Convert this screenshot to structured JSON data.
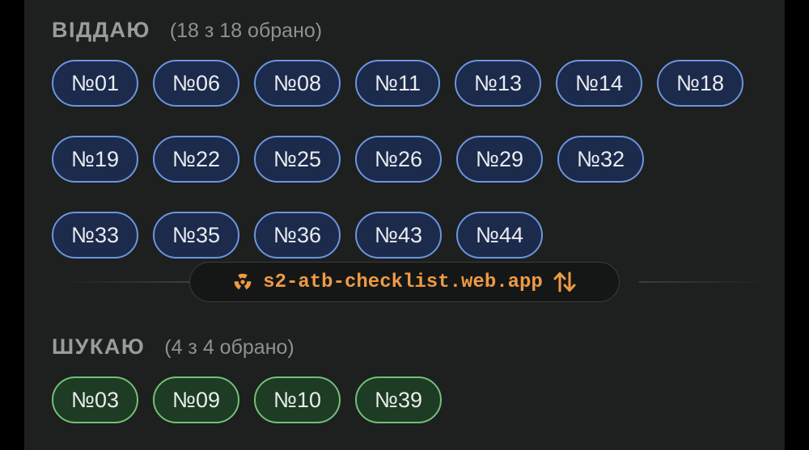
{
  "give": {
    "title": "ВІДДАЮ",
    "count": "(18 з 18 обрано)",
    "rows": [
      [
        "№01",
        "№06",
        "№08",
        "№11",
        "№13",
        "№14",
        "№18"
      ],
      [
        "№19",
        "№22",
        "№25",
        "№26",
        "№29",
        "№32"
      ],
      [
        "№33",
        "№35",
        "№36",
        "№43",
        "№44"
      ]
    ]
  },
  "app_link": {
    "icon": "radiation-icon",
    "url": "s2-atb-checklist.web.app",
    "swap_icon": "swap-vertical-icon",
    "color": "#ee9a45"
  },
  "seek": {
    "title": "ШУКАЮ",
    "count": "(4 з 4 обрано)",
    "rows": [
      [
        "№03",
        "№09",
        "№10",
        "№39"
      ]
    ]
  },
  "colors": {
    "give_border": "#6b95df",
    "give_fill": "#1c2a4c",
    "seek_border": "#72c07a",
    "seek_fill": "#1e3b23",
    "background": "#1d201e"
  }
}
